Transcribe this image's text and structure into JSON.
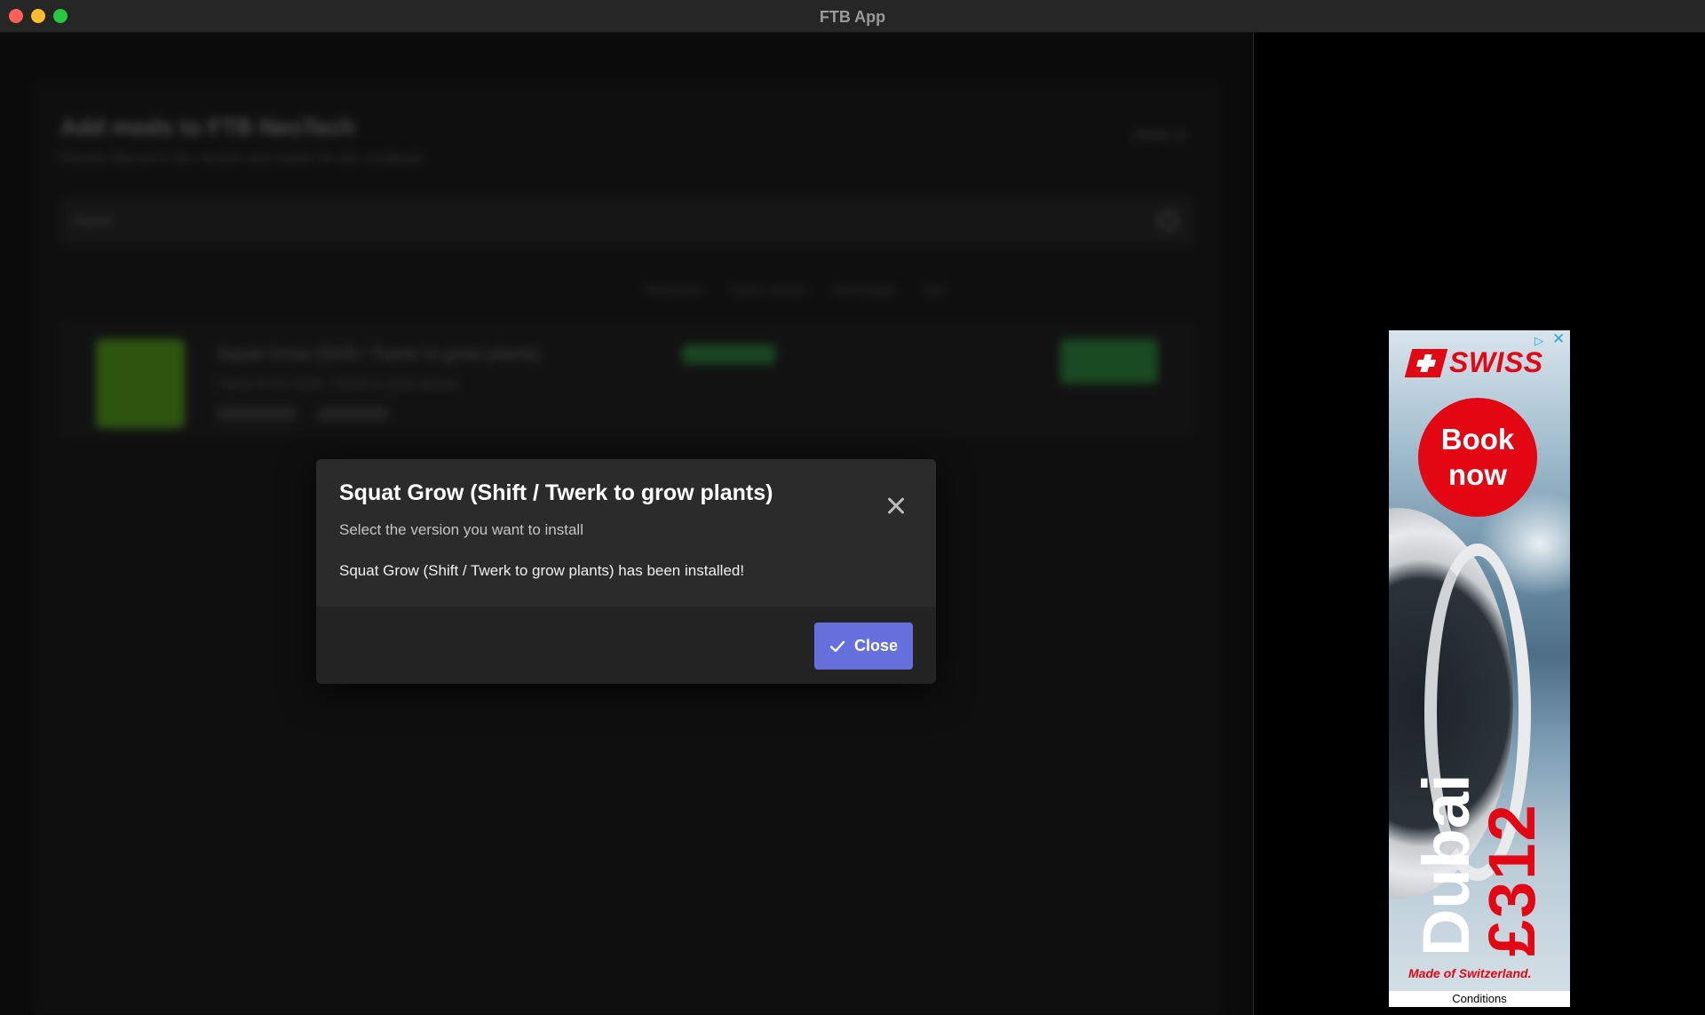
{
  "window": {
    "title": "FTB App"
  },
  "background": {
    "title": "Add mods to FTB NeoTech",
    "subtitle": "Results filtered to the version and loader for this modpack",
    "close_link": "Close ✕",
    "search_value": "Squat",
    "filters": [
      "Relevance",
      "Game version",
      "Mod loader",
      "Sort"
    ],
    "card": {
      "title": "Squat Grow (Shift / Twerk to grow plants)",
      "subtitle": "Squat Grow (Shift / Twerk to grow plants)"
    }
  },
  "modal": {
    "title": "Squat Grow (Shift / Twerk to grow plants)",
    "subtitle": "Select the version you want to install",
    "message": "Squat Grow (Shift / Twerk to grow plants) has been installed!",
    "close_button": "Close"
  },
  "ad": {
    "brand": "SWISS",
    "cta_line1": "Book",
    "cta_line2": "now",
    "destination": "Dubai",
    "price": "£312",
    "tagline": "Made of Switzerland.",
    "conditions": "Conditions",
    "choices_glyph": "▷",
    "close_glyph": "✕"
  },
  "colors": {
    "accent": "#6570dd",
    "brand_red": "#e30613"
  }
}
